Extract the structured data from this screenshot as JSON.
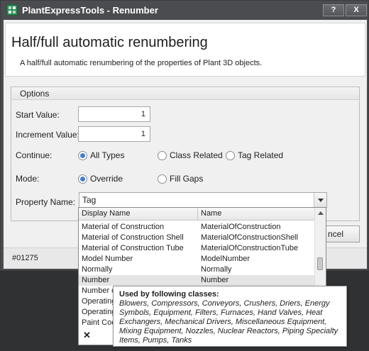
{
  "window": {
    "title": "PlantExpressTools - Renumber",
    "help_label": "?",
    "close_label": "X"
  },
  "header": {
    "title": "Half/full automatic renumbering",
    "description": "A half/full automatic renumbering of the properties of Plant 3D objects."
  },
  "options": {
    "legend": "Options",
    "start_value_label": "Start Value:",
    "start_value": "1",
    "increment_value_label": "Increment Value:",
    "increment_value": "1",
    "continue_label": "Continue:",
    "continue_options": [
      "All Types",
      "Class Related",
      "Tag Related"
    ],
    "continue_selected": "All Types",
    "mode_label": "Mode:",
    "mode_options": [
      "Override",
      "Fill Gaps"
    ],
    "mode_selected": "Override",
    "property_name_label": "Property Name:",
    "property_name_value": "Tag"
  },
  "buttons": {
    "cancel_label": "ncel"
  },
  "status": {
    "text": "#01275"
  },
  "dropdown": {
    "columns": [
      "Display Name",
      "Name"
    ],
    "rows": [
      {
        "display": "Material of Construction",
        "name": "MaterialOfConstruction"
      },
      {
        "display": "Material of Construction Shell",
        "name": "MaterialOfConstructionShell"
      },
      {
        "display": "Material of Construction Tube",
        "name": "MaterialOfConstructionTube"
      },
      {
        "display": "Model Number",
        "name": "ModelNumber"
      },
      {
        "display": "Normally",
        "name": "Normally"
      },
      {
        "display": "Number",
        "name": "Number"
      },
      {
        "display": "Number o",
        "name": ""
      },
      {
        "display": "Operating",
        "name": ""
      },
      {
        "display": "Operating",
        "name": ""
      },
      {
        "display": "Paint Coc",
        "name": ""
      }
    ],
    "selected_row": "Number",
    "close_label": "✕"
  },
  "tooltip": {
    "title": "Used by following classes:",
    "body": "Blowers, Compressors, Conveyors, Crushers, Driers, Energy Symbols, Equipment, Filters, Furnaces, Hand Valves, Heat Exchangers, Mechanical Drivers, Miscellaneous Equipment, Mixing Equipment, Nozzles, Nuclear Reactors, Piping Specialty Items, Pumps, Tanks"
  },
  "colors": {
    "accent": "#3f7fd3",
    "titlebar": "#4a4c4f",
    "background": "#2f3133"
  }
}
